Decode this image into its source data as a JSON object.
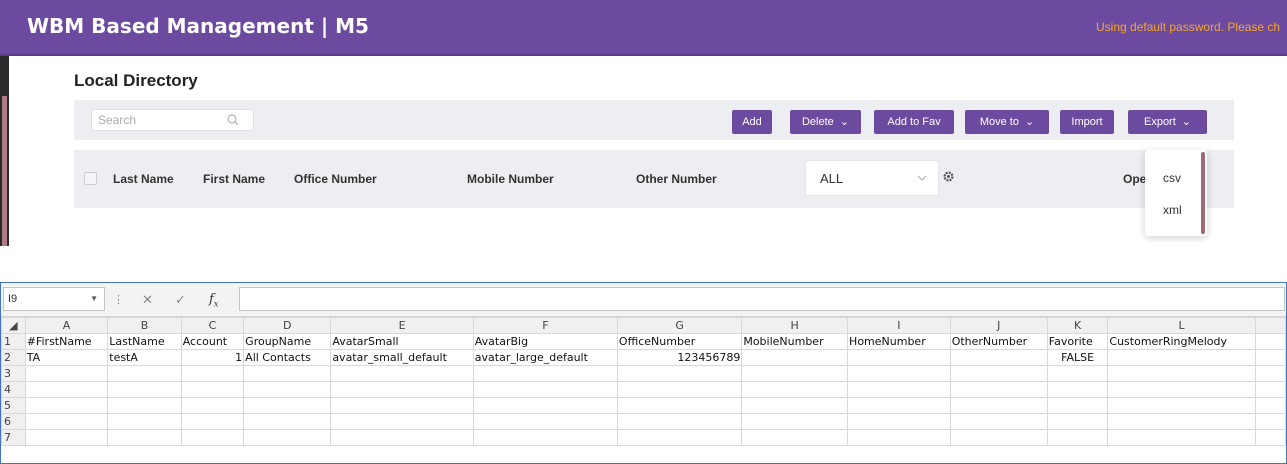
{
  "header": {
    "title": "WBM Based Management | M5",
    "warning": "Using default password. Please ch"
  },
  "page": {
    "title": "Local Directory"
  },
  "search": {
    "placeholder": "Search"
  },
  "toolbar": {
    "add": "Add",
    "delete": "Delete",
    "add_to_fav": "Add to Fav",
    "move_to": "Move to",
    "import": "Import",
    "export": "Export"
  },
  "table": {
    "columns": {
      "last_name": "Last Name",
      "first_name": "First Name",
      "office_number": "Office Number",
      "mobile_number": "Mobile Number",
      "other_number": "Other Number",
      "operation": "Ope"
    },
    "group_filter": "ALL"
  },
  "export_menu": {
    "options": [
      "csv",
      "xml"
    ]
  },
  "spreadsheet": {
    "name_box": "I9",
    "formula": "",
    "column_letters": [
      "A",
      "B",
      "C",
      "D",
      "E",
      "F",
      "G",
      "H",
      "I",
      "J",
      "K",
      "L"
    ],
    "row_numbers": [
      "1",
      "2",
      "3",
      "4",
      "5",
      "6",
      "7"
    ],
    "rows": [
      [
        "#FirstName",
        "LastName",
        "Account",
        "GroupName",
        "AvatarSmall",
        "AvatarBig",
        "OfficeNumber",
        "MobileNumber",
        "HomeNumber",
        "OtherNumber",
        "Favorite",
        "CustomerRingMelody"
      ],
      [
        "TA",
        "testA",
        "1",
        "All Contacts",
        "avatar_small_default",
        "avatar_large_default",
        "123456789",
        "",
        "",
        "",
        "FALSE",
        ""
      ]
    ]
  },
  "colors": {
    "brand": "#6b4aa0",
    "warning": "#f4a62a",
    "excel_border": "#4472c4"
  }
}
